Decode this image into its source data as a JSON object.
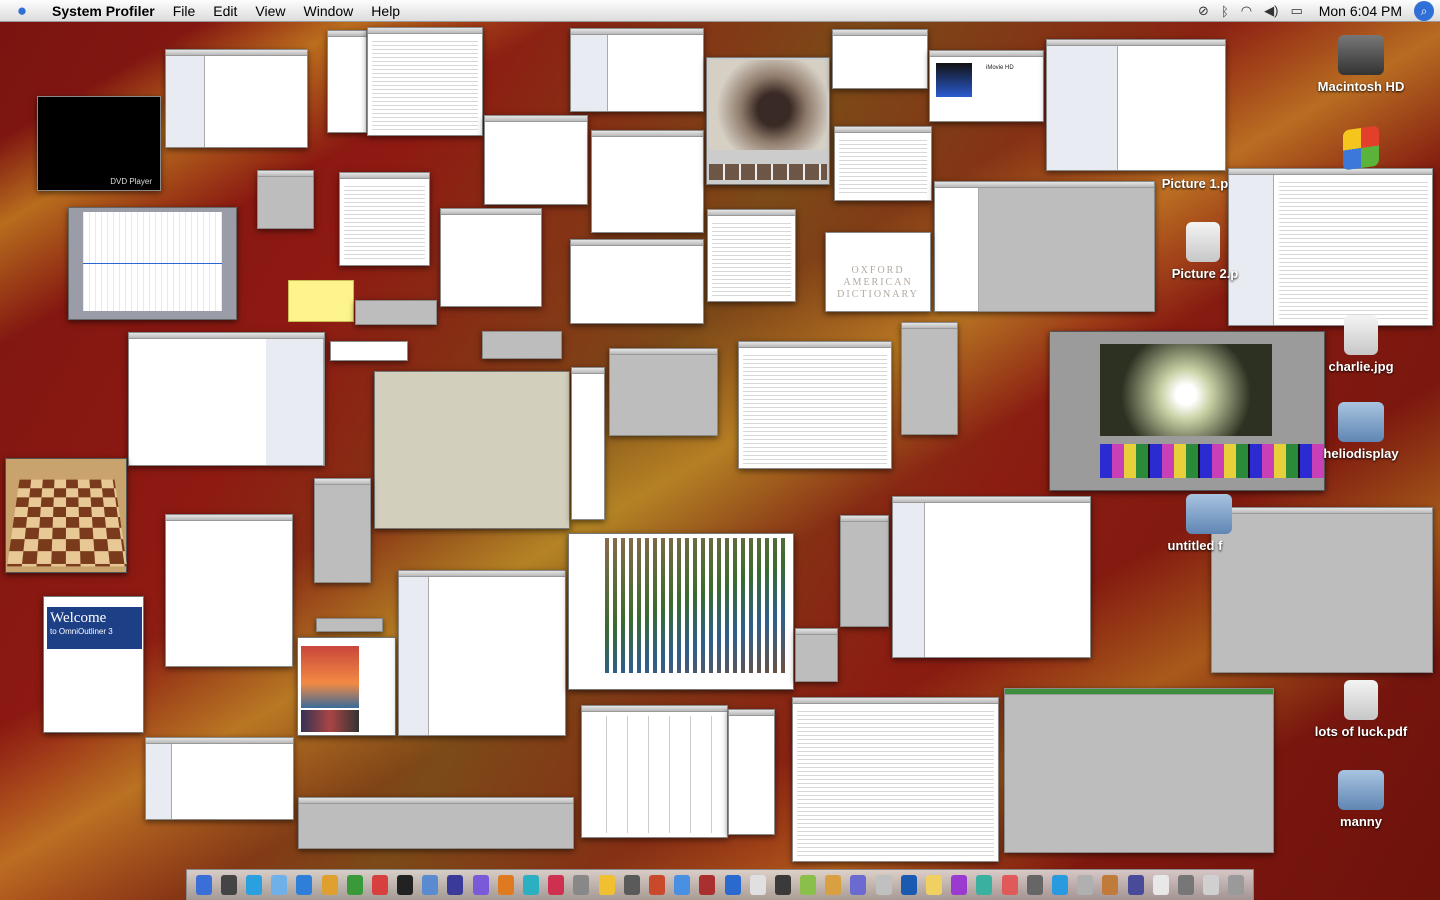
{
  "menubar": {
    "app_name": "System Profiler",
    "items": [
      "File",
      "Edit",
      "View",
      "Window",
      "Help"
    ],
    "clock": "Mon 6:04 PM",
    "status_icons": [
      "airport-off-icon",
      "bluetooth-icon",
      "wifi-icon",
      "volume-icon",
      "battery-icon",
      "spotlight-icon"
    ]
  },
  "desktop_icons": [
    {
      "label": "Macintosh HD",
      "kind": "hd"
    },
    {
      "label": "Picture 1.p",
      "kind": "doc"
    },
    {
      "label": "Picture 2.p",
      "kind": "doc"
    },
    {
      "label": "charlie.jpg",
      "kind": "doc"
    },
    {
      "label": "heliodisplay",
      "kind": "folder"
    },
    {
      "label": "untitled f",
      "kind": "folder"
    },
    {
      "label": "lots of luck.pdf",
      "kind": "doc"
    },
    {
      "label": "manny",
      "kind": "folder"
    }
  ],
  "windows": {
    "dvd_player_label": "DVD Player",
    "omnioutliner_title": "Welcome",
    "omnioutliner_subtitle": "to OmniOutliner 3",
    "oxford_lines": [
      "OXFORD",
      "AMERICAN",
      "DICTIONARY"
    ],
    "imovie_label": "iMovie HD"
  },
  "colors": {
    "desktop_red": "#8e1a12",
    "desktop_gold": "#e6b428",
    "spotlight_blue": "#2f6fd6"
  }
}
